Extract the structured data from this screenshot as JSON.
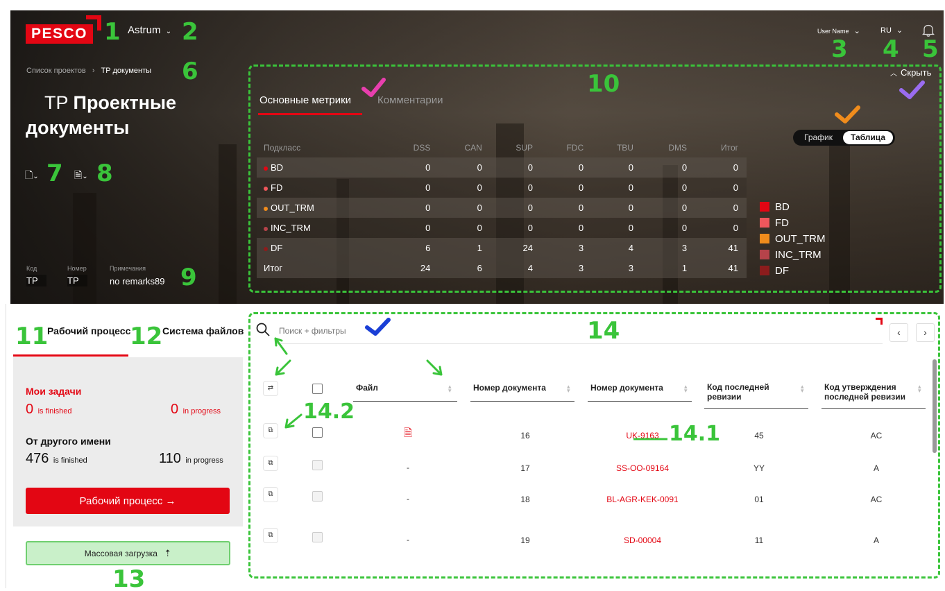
{
  "header": {
    "logo": "PESCO",
    "project": "Astrum",
    "user": "User Name",
    "lang": "RU"
  },
  "breadcrumb": {
    "parent": "Список проектов",
    "sep": "›",
    "current": "TP документы"
  },
  "title": {
    "prefix": "TP",
    "bold": "Проектные документы"
  },
  "meta": {
    "code_label": "Код",
    "code_value": "TP",
    "number_label": "Номер",
    "number_value": "TP",
    "notes_label": "Примечания",
    "notes_value": "no remarks89"
  },
  "metrics": {
    "tabs": [
      "Основные метрики",
      "Комментарии"
    ],
    "hide_label": "Скрыть",
    "toggle": [
      "График",
      "Таблица"
    ],
    "columns": [
      "Подкласс",
      "DSS",
      "CAN",
      "SUP",
      "FDC",
      "TBU",
      "DMS",
      "Итог"
    ],
    "rows": [
      {
        "name": "BD",
        "color": "#e30613",
        "values": [
          "0",
          "0",
          "0",
          "0",
          "0",
          "0",
          "0"
        ]
      },
      {
        "name": "FD",
        "color": "#f0575c",
        "values": [
          "0",
          "0",
          "0",
          "0",
          "0",
          "0",
          "0"
        ]
      },
      {
        "name": "OUT_TRM",
        "color": "#f08c1c",
        "values": [
          "0",
          "0",
          "0",
          "0",
          "0",
          "0",
          "0"
        ]
      },
      {
        "name": "INC_TRM",
        "color": "#b5434a",
        "values": [
          "0",
          "0",
          "0",
          "0",
          "0",
          "0",
          "0"
        ]
      },
      {
        "name": "DF",
        "color": "#8c1c1c",
        "values": [
          "6",
          "1",
          "24",
          "3",
          "4",
          "3",
          "41"
        ]
      }
    ],
    "total": {
      "name": "Итог",
      "values": [
        "24",
        "6",
        "4",
        "3",
        "3",
        "1",
        "41"
      ]
    },
    "legend": [
      {
        "name": "BD",
        "color": "#e30613"
      },
      {
        "name": "FD",
        "color": "#f0575c"
      },
      {
        "name": "OUT_TRM",
        "color": "#f08c1c"
      },
      {
        "name": "INC_TRM",
        "color": "#b5434a"
      },
      {
        "name": "DF",
        "color": "#8c1c1c"
      }
    ]
  },
  "workflow": {
    "tab1": "Рабочий процесс",
    "tab2": "Система файлов",
    "my_tasks": "Мои задачи",
    "my_finished": "0",
    "my_finished_lbl": "is finished",
    "my_progress": "0",
    "my_progress_lbl": "in progress",
    "other": "От другого имени",
    "other_finished": "476",
    "other_finished_lbl": "is finished",
    "other_progress": "110",
    "other_progress_lbl": "in progress",
    "button": "Рабочий процесс  →",
    "mass_upload": "Массовая загрузка"
  },
  "docs": {
    "search_placeholder": "Поиск + фильтры",
    "columns": [
      "Файл",
      "Номер документа",
      "Номер документа",
      "Код последней ревизии",
      "Код утверждения последней ревизии"
    ],
    "rows": [
      {
        "file": "pdf",
        "num": "16",
        "doc": "UK-9163",
        "rev": "45",
        "appr": "AC"
      },
      {
        "file": "-",
        "num": "17",
        "doc": "SS-OO-09164",
        "rev": "YY",
        "appr": "A"
      },
      {
        "file": "-",
        "num": "18",
        "doc": "BL-AGR-KEK-0091",
        "rev": "01",
        "appr": "AC"
      },
      {
        "file": "-",
        "num": "19",
        "doc": "SD-00004",
        "rev": "11",
        "appr": "A"
      }
    ]
  },
  "annotations": [
    "1",
    "2",
    "3",
    "4",
    "5",
    "6",
    "7",
    "8",
    "9",
    "10",
    "11",
    "12",
    "13",
    "14",
    "14.1",
    "14.2"
  ],
  "colors": {
    "accent": "#e30613",
    "annotation": "#3ac43a",
    "check_pink": "#e83fae",
    "check_purple": "#9a6cf0",
    "check_orange": "#f08c1c",
    "check_blue": "#1a3fd6"
  }
}
